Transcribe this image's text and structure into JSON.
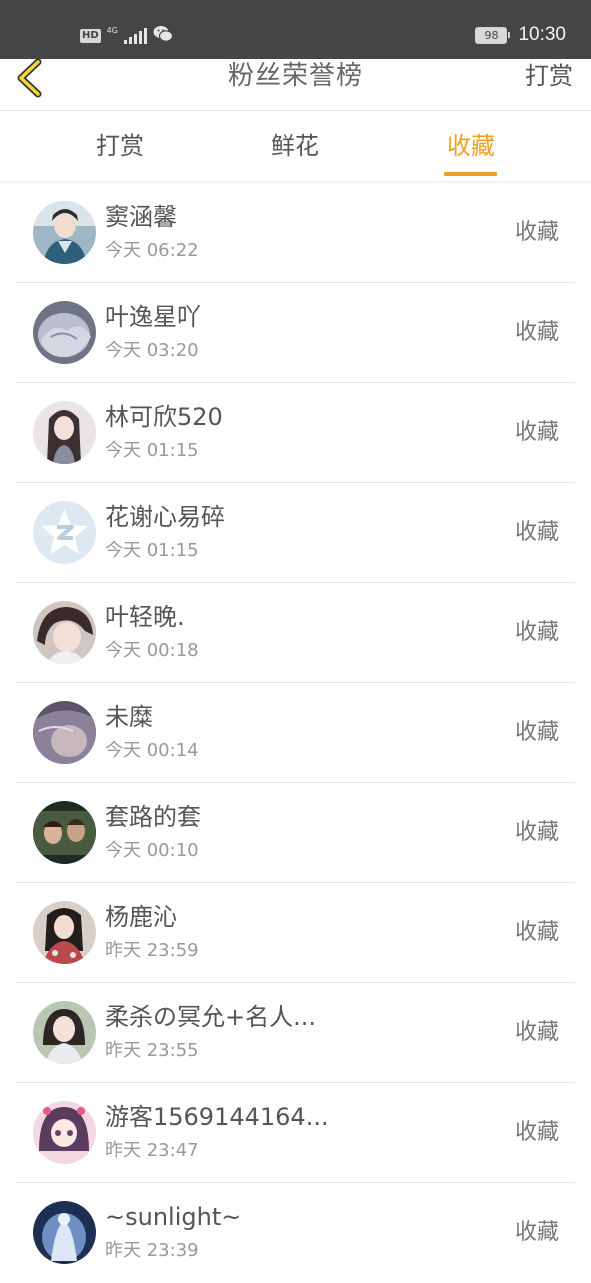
{
  "status_bar": {
    "hd": "HD",
    "network": "4G",
    "battery": "98",
    "time": "10:30"
  },
  "header": {
    "back_icon": "chevron-left-icon",
    "title": "粉丝荣誉榜",
    "action": "打赏"
  },
  "tabs": [
    {
      "label": "打赏",
      "active": false
    },
    {
      "label": "鲜花",
      "active": false
    },
    {
      "label": "收藏",
      "active": true
    }
  ],
  "colors": {
    "accent": "#f0a020",
    "status_bar_bg": "#444547"
  },
  "fans": [
    {
      "name": "窦涵馨",
      "time": "今天 06:22",
      "action": "收藏"
    },
    {
      "name": "叶逸星吖",
      "time": "今天 03:20",
      "action": "收藏"
    },
    {
      "name": "林可欣520",
      "time": "今天 01:15",
      "action": "收藏"
    },
    {
      "name": "花谢心易碎",
      "time": "今天 01:15",
      "action": "收藏"
    },
    {
      "name": "叶轻晚.",
      "time": "今天 00:18",
      "action": "收藏"
    },
    {
      "name": "未糜",
      "time": "今天 00:14",
      "action": "收藏"
    },
    {
      "name": "套路的套",
      "time": "今天 00:10",
      "action": "收藏"
    },
    {
      "name": "杨鹿沁",
      "time": "昨天 23:59",
      "action": "收藏"
    },
    {
      "name": "柔杀の冥允+名人...",
      "time": "昨天 23:55",
      "action": "收藏"
    },
    {
      "name": "游客1569144164...",
      "time": "昨天 23:47",
      "action": "收藏"
    },
    {
      "name": "~sunlight~",
      "time": "昨天 23:39",
      "action": "收藏"
    }
  ]
}
